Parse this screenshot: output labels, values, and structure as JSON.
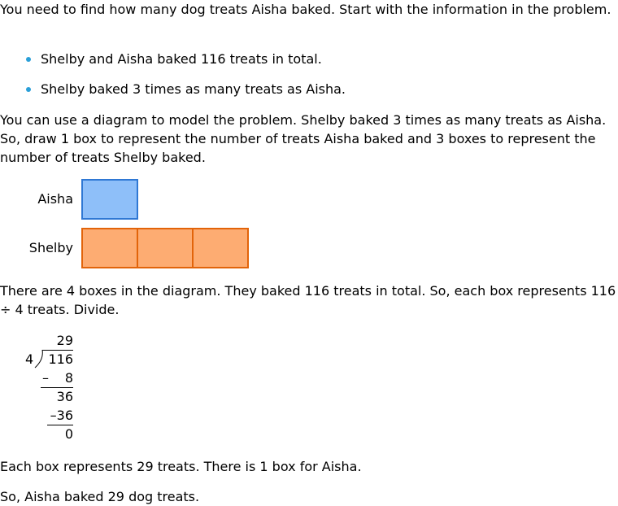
{
  "intro": "You need to find how many dog treats Aisha baked. Start with the information in the problem.",
  "bullets": [
    "Shelby and Aisha baked 116 treats in total.",
    "Shelby baked 3 times as many treats as Aisha."
  ],
  "diagram_intro": "You can use a diagram to model the problem. Shelby baked 3 times as many treats as Aisha. So, draw 1 box to represent the number of treats Aisha baked and 3 boxes to represent the number of treats Shelby baked.",
  "diagram": {
    "rows": [
      {
        "label": "Aisha",
        "boxes": 1,
        "color": "#8ebff9",
        "border": "#2f78d4"
      },
      {
        "label": "Shelby",
        "boxes": 3,
        "color": "#fdac72",
        "border": "#e2640a"
      }
    ]
  },
  "division_intro": "There are 4 boxes in the diagram. They baked 116 treats in total. So, each box represents 116 ÷ 4 treats. Divide.",
  "long_division": {
    "quotient": "29",
    "divisor": "4",
    "dividend": "116",
    "step1_sign": "–",
    "step1_sub": "8",
    "step1_rem": "36",
    "step2_sub": "–36",
    "final": "0"
  },
  "result1": "Each box represents 29 treats. There is 1 box for Aisha.",
  "result2": "So, Aisha baked 29 dog treats."
}
